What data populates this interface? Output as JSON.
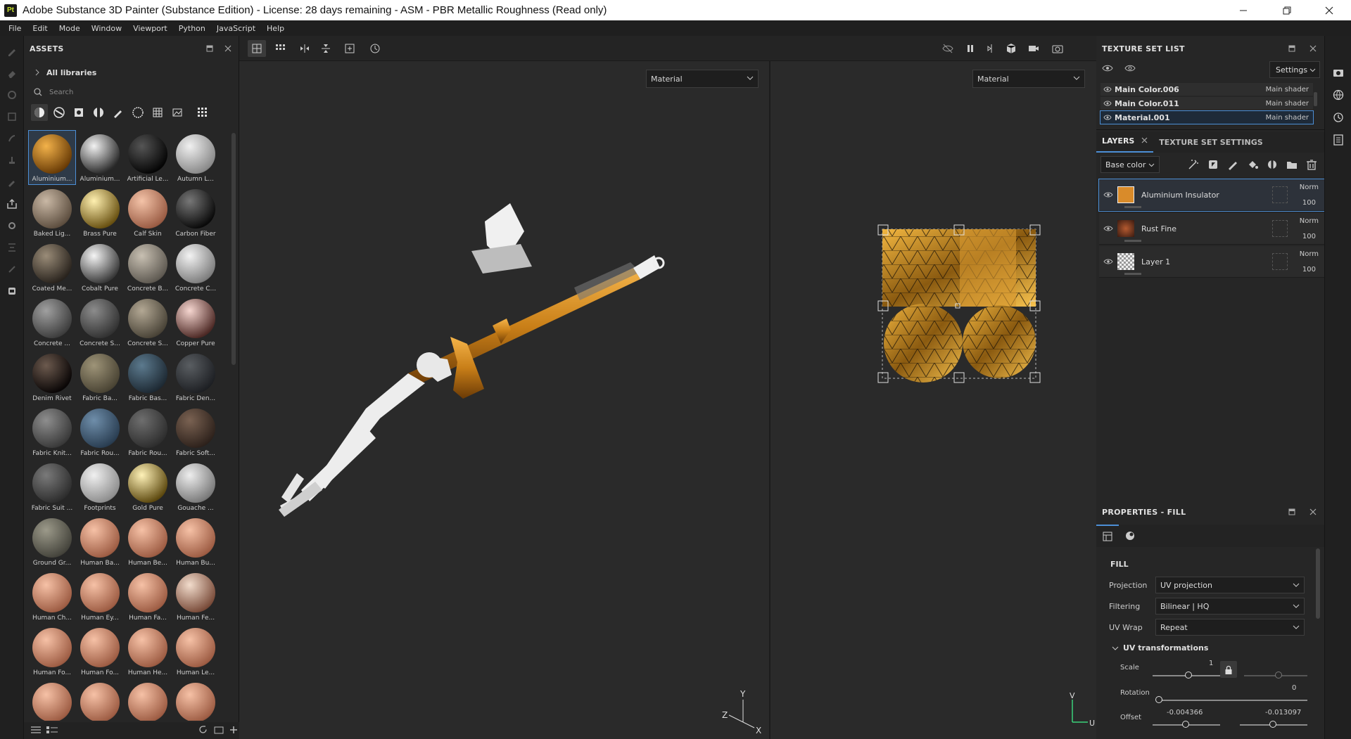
{
  "titlebar": {
    "app_icon": "Pt",
    "title": "Adobe Substance 3D Painter (Substance Edition) - License: 28 days remaining - ASM - PBR Metallic Roughness (Read only)"
  },
  "menu": [
    "File",
    "Edit",
    "Mode",
    "Window",
    "Viewport",
    "Python",
    "JavaScript",
    "Help"
  ],
  "assets": {
    "title": "ASSETS",
    "breadcrumb": "All libraries",
    "search_placeholder": "Search",
    "items": [
      {
        "label": "Aluminium...",
        "c1": "#f3b24a",
        "c2": "#6a3c06",
        "selected": true
      },
      {
        "label": "Aluminium...",
        "c1": "#f2f2f2",
        "c2": "#2a2a2a"
      },
      {
        "label": "Artificial Le...",
        "c1": "#555555",
        "c2": "#050505"
      },
      {
        "label": "Autumn L...",
        "c1": "#f0f0f0",
        "c2": "#8a8a8a"
      },
      {
        "label": "Baked Lig...",
        "c1": "#c9b8a5",
        "c2": "#5e4f40"
      },
      {
        "label": "Brass Pure",
        "c1": "#fff0b0",
        "c2": "#6a5212"
      },
      {
        "label": "Calf Skin",
        "c1": "#f4c3a8",
        "c2": "#9a5c44"
      },
      {
        "label": "Carbon Fiber",
        "c1": "#777777",
        "c2": "#0a0a0a"
      },
      {
        "label": "Coated Me...",
        "c1": "#9a8c78",
        "c2": "#2a241e"
      },
      {
        "label": "Cobalt Pure",
        "c1": "#f5f5f5",
        "c2": "#3a3a3a"
      },
      {
        "label": "Concrete B...",
        "c1": "#c8c0b2",
        "c2": "#5f5a52"
      },
      {
        "label": "Concrete C...",
        "c1": "#f3f3f3",
        "c2": "#7e7e7e"
      },
      {
        "label": "Concrete ...",
        "c1": "#a0a0a0",
        "c2": "#3e3e3e"
      },
      {
        "label": "Concrete S...",
        "c1": "#8c8c8c",
        "c2": "#333333"
      },
      {
        "label": "Concrete S...",
        "c1": "#b3a894",
        "c2": "#4a4438"
      },
      {
        "label": "Copper Pure",
        "c1": "#f6d6d0",
        "c2": "#4e2a26"
      },
      {
        "label": "Denim Rivet",
        "c1": "#6c5a4e",
        "c2": "#0a0606"
      },
      {
        "label": "Fabric Ba...",
        "c1": "#9e9478",
        "c2": "#4a4434"
      },
      {
        "label": "Fabric Bas...",
        "c1": "#5c7a8e",
        "c2": "#1e2a34"
      },
      {
        "label": "Fabric Den...",
        "c1": "#5a5e62",
        "c2": "#1e2024"
      },
      {
        "label": "Fabric Knit...",
        "c1": "#8e8e8e",
        "c2": "#3a3a3a"
      },
      {
        "label": "Fabric Rou...",
        "c1": "#6f8eaa",
        "c2": "#2a3e52"
      },
      {
        "label": "Fabric Rou...",
        "c1": "#6e6e6e",
        "c2": "#2e2e2e"
      },
      {
        "label": "Fabric Soft...",
        "c1": "#7a6252",
        "c2": "#2e221c"
      },
      {
        "label": "Fabric Suit ...",
        "c1": "#7a7a7a",
        "c2": "#2e2e2e"
      },
      {
        "label": "Footprints",
        "c1": "#f0f0f0",
        "c2": "#8e8e8e"
      },
      {
        "label": "Gold Pure",
        "c1": "#fff2b8",
        "c2": "#5e4a10"
      },
      {
        "label": "Gouache ...",
        "c1": "#eeeeee",
        "c2": "#7a7a7a"
      },
      {
        "label": "Ground Gr...",
        "c1": "#9c9a8a",
        "c2": "#45443c"
      },
      {
        "label": "Human Ba...",
        "c1": "#f6c1a6",
        "c2": "#9e5d44"
      },
      {
        "label": "Human Be...",
        "c1": "#f6c1a6",
        "c2": "#9e5d44"
      },
      {
        "label": "Human Bu...",
        "c1": "#f6c1a6",
        "c2": "#9e5d44"
      },
      {
        "label": "Human Ch...",
        "c1": "#f6c1a6",
        "c2": "#9e5d44"
      },
      {
        "label": "Human Ey...",
        "c1": "#f6c1a6",
        "c2": "#9e5d44"
      },
      {
        "label": "Human Fa...",
        "c1": "#f6c1a6",
        "c2": "#9e5d44"
      },
      {
        "label": "Human Fe...",
        "c1": "#f2dccc",
        "c2": "#7a4c3a"
      },
      {
        "label": "Human Fo...",
        "c1": "#f6c1a6",
        "c2": "#9e5d44"
      },
      {
        "label": "Human Fo...",
        "c1": "#f6c1a6",
        "c2": "#9e5d44"
      },
      {
        "label": "Human He...",
        "c1": "#f6c1a6",
        "c2": "#9e5d44"
      },
      {
        "label": "Human Le...",
        "c1": "#f6c1a6",
        "c2": "#9e5d44"
      },
      {
        "label": "",
        "c1": "#f6c1a6",
        "c2": "#9e5d44"
      },
      {
        "label": "",
        "c1": "#f6c1a6",
        "c2": "#9e5d44"
      },
      {
        "label": "",
        "c1": "#f6c1a6",
        "c2": "#9e5d44"
      },
      {
        "label": "",
        "c1": "#f6c1a6",
        "c2": "#9e5d44"
      }
    ]
  },
  "viewport": {
    "left_dropdown": "Material",
    "right_dropdown": "Material",
    "gizmo_3d": {
      "y": "Y",
      "z": "Z",
      "x": "X"
    },
    "gizmo_2d": {
      "v": "V",
      "u": "U"
    }
  },
  "texture_set_list": {
    "title": "TEXTURE SET LIST",
    "settings_label": "Settings",
    "rows": [
      {
        "name": "Main Color.006",
        "shader": "Main shader"
      },
      {
        "name": "Main Color.011",
        "shader": "Main shader"
      },
      {
        "name": "Material.001",
        "shader": "Main shader"
      }
    ]
  },
  "layers": {
    "tab_layers": "LAYERS",
    "tab_settings": "TEXTURE SET SETTINGS",
    "channel": "Base color",
    "items": [
      {
        "name": "Aluminium Insulator",
        "blend": "Norm",
        "opacity": "100",
        "thumb": "#d98b2a"
      },
      {
        "name": "Rust Fine",
        "blend": "Norm",
        "opacity": "100",
        "thumb": "#7a3a22"
      },
      {
        "name": "Layer 1",
        "blend": "Norm",
        "opacity": "100",
        "thumb": "checker"
      }
    ]
  },
  "properties": {
    "title": "PROPERTIES - FILL",
    "section": "FILL",
    "projection_label": "Projection",
    "projection_value": "UV projection",
    "filtering_label": "Filtering",
    "filtering_value": "Bilinear | HQ",
    "uvwrap_label": "UV Wrap",
    "uvwrap_value": "Repeat",
    "uv_transform_label": "UV transformations",
    "scale_label": "Scale",
    "scale_value": "1",
    "rotation_label": "Rotation",
    "rotation_value": "0",
    "offset_label": "Offset",
    "offset_u": "-0.004366",
    "offset_v": "-0.013097"
  }
}
